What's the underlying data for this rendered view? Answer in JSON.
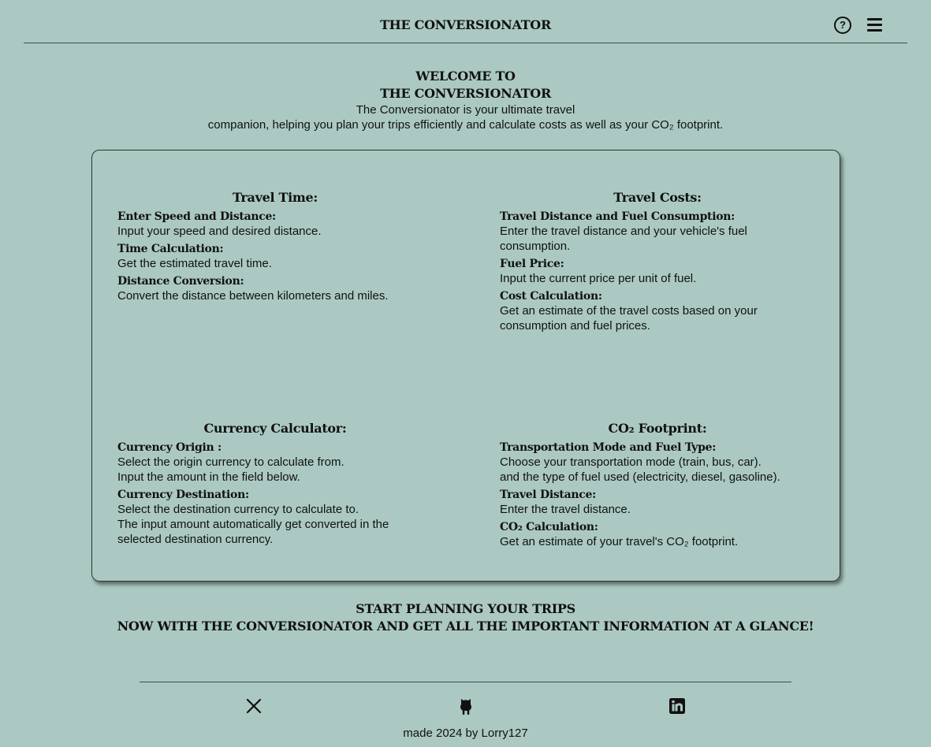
{
  "header": {
    "brand": "THE CONVERSIONATOR",
    "help_icon": "question-circle-icon",
    "help_glyph": "?",
    "menu_icon": "hamburger-menu-icon"
  },
  "intro": {
    "title_line1": "WELCOME TO",
    "title_line2": "THE CONVERSIONATOR",
    "text_line1": "The Conversionator is your ultimate travel",
    "text_line2": "companion, helping you plan your trips efficiently and calculate costs as well as your CO₂ footprint."
  },
  "sections": {
    "travel_time": {
      "title": "Travel Time:",
      "items": [
        {
          "heading": "Enter Speed and Distance:",
          "text": "Input your speed and desired distance."
        },
        {
          "heading": "Time Calculation:",
          "text": "Get the estimated travel time."
        },
        {
          "heading": "Distance Conversion:",
          "text": "Convert the distance between kilometers and miles."
        }
      ]
    },
    "travel_costs": {
      "title": "Travel Costs:",
      "items": [
        {
          "heading": "Travel Distance and Fuel Consumption:",
          "text": "Enter the travel distance and your vehicle's fuel consumption."
        },
        {
          "heading": "Fuel Price:",
          "text": "Input the current price per unit of fuel."
        },
        {
          "heading": "Cost Calculation:",
          "text": "Get an estimate of the travel costs based on your consumption and fuel prices."
        }
      ]
    },
    "currency": {
      "title": "Currency Calculator:",
      "items": [
        {
          "heading": "Currency Origin :",
          "text1": "Select the origin currency to calculate from.",
          "text2": "Input the amount in the field below."
        },
        {
          "heading": "Currency Destination:",
          "text1": "Select the destination currency to calculate to.",
          "text2": "The input amount automatically get converted in the selected destination currency."
        }
      ]
    },
    "co2": {
      "title": "CO₂ Footprint:",
      "items": [
        {
          "heading": "Transportation Mode and Fuel Type:",
          "text1": "Choose your transportation mode (train, bus, car).",
          "text2": "and the type of fuel used (electricity, diesel, gasoline)."
        },
        {
          "heading": "Travel Distance:",
          "text": "Enter the travel distance."
        },
        {
          "heading": "CO₂ Calculation:",
          "text": "Get an estimate of your travel's CO₂ footprint."
        }
      ]
    }
  },
  "cta": {
    "line1": "START PLANNING YOUR TRIPS",
    "line2": "NOW WITH THE CONVERSIONATOR AND GET ALL THE IMPORTANT INFORMATION AT A GLANCE!"
  },
  "footer": {
    "social_icons": [
      "x-twitter-icon",
      "github-icon",
      "linkedin-icon"
    ],
    "made_by": "made 2024 by Lorry127"
  },
  "colors": {
    "background": "#abc9c2",
    "text": "#111111",
    "rule": "#3d4d49"
  }
}
